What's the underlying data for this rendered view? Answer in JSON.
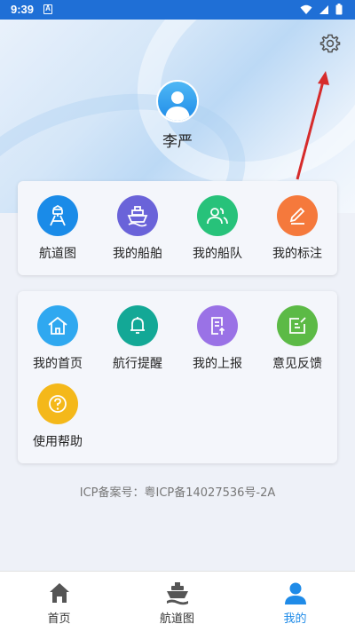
{
  "status_bar": {
    "time": "9:39",
    "notification_icon": "A"
  },
  "profile": {
    "username": "李严"
  },
  "colors": {
    "accent": "#1f8be8",
    "status_bar": "#1f6fd6",
    "arrow": "#d62b2b"
  },
  "quick_menu": [
    {
      "label": "航道图",
      "icon": "channel-map-icon",
      "color": "#1a8be8"
    },
    {
      "label": "我的船舶",
      "icon": "ship-icon",
      "color": "#6a63d9"
    },
    {
      "label": "我的船队",
      "icon": "fleet-people-icon",
      "color": "#27c27a"
    },
    {
      "label": "我的标注",
      "icon": "pencil-icon",
      "color": "#f5793c"
    }
  ],
  "service_menu": [
    {
      "label": "我的首页",
      "icon": "home-icon",
      "color": "#2fa8f0"
    },
    {
      "label": "航行提醒",
      "icon": "bell-icon",
      "color": "#13a896"
    },
    {
      "label": "我的上报",
      "icon": "report-icon",
      "color": "#9a72e6"
    },
    {
      "label": "意见反馈",
      "icon": "feedback-icon",
      "color": "#5cba46"
    },
    {
      "label": "使用帮助",
      "icon": "help-icon",
      "color": "#f4b81a"
    }
  ],
  "footer": {
    "icp": "ICP备案号：粤ICP备14027536号-2A"
  },
  "tabs": [
    {
      "label": "首页",
      "icon": "home-icon",
      "active": false
    },
    {
      "label": "航道图",
      "icon": "ship-icon",
      "active": false
    },
    {
      "label": "我的",
      "icon": "user-icon",
      "active": true
    }
  ]
}
